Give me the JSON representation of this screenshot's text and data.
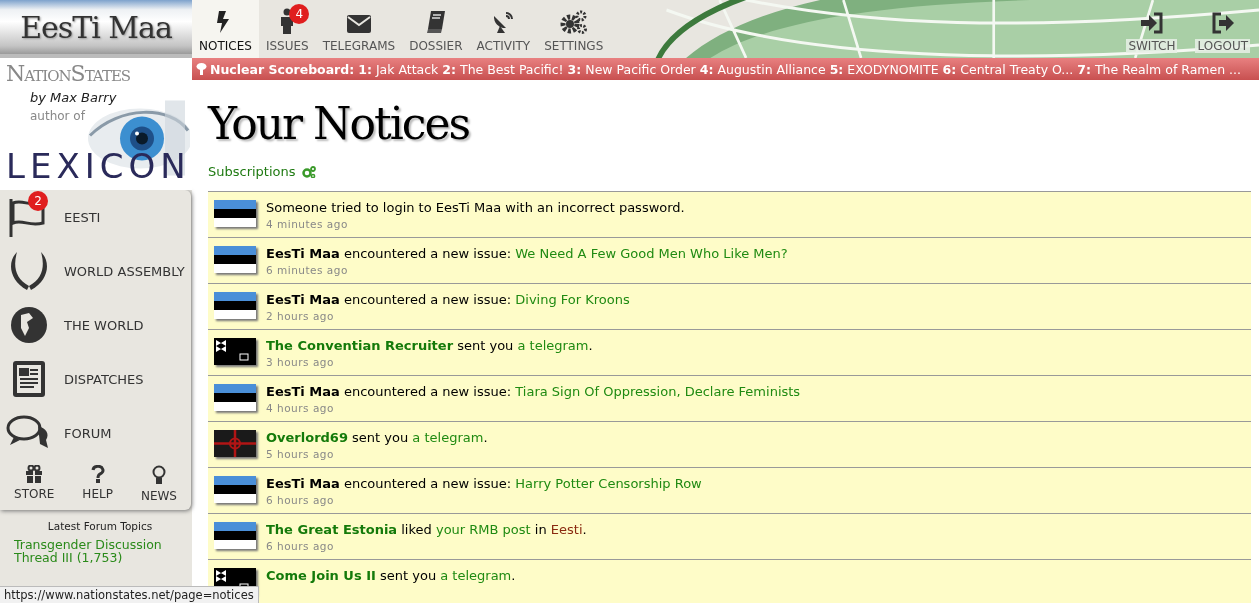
{
  "nation_banner": {
    "name": "EesTi Maa"
  },
  "nav": [
    {
      "label": "NOTICES",
      "selected": true
    },
    {
      "label": "ISSUES",
      "selected": false,
      "badge": "4"
    },
    {
      "label": "TELEGRAMS",
      "selected": false
    },
    {
      "label": "DOSSIER",
      "selected": false
    },
    {
      "label": "ACTIVITY",
      "selected": false
    },
    {
      "label": "SETTINGS",
      "selected": false
    }
  ],
  "account_nav": [
    {
      "label": "SWITCH"
    },
    {
      "label": "LOGOUT"
    }
  ],
  "ticker": {
    "label": "Nuclear Scoreboard:",
    "entries": [
      {
        "rank": "1:",
        "name": "Jak Attack"
      },
      {
        "rank": "2:",
        "name": "The Best Pacific!"
      },
      {
        "rank": "3:",
        "name": "New Pacific Order"
      },
      {
        "rank": "4:",
        "name": "Augustin Alliance"
      },
      {
        "rank": "5:",
        "name": "EXODYNOMITE"
      },
      {
        "rank": "6:",
        "name": "Central Treaty O..."
      },
      {
        "rank": "7:",
        "name": "The Realm of Ramen ..."
      }
    ]
  },
  "site_logo": "NationStates",
  "promo": {
    "byline": "by Max Barry",
    "subline": "author of",
    "book": "LEXICON"
  },
  "sidebar": {
    "items": [
      {
        "label": "EESTI",
        "badge": "2"
      },
      {
        "label": "WORLD ASSEMBLY"
      },
      {
        "label": "THE WORLD"
      },
      {
        "label": "DISPATCHES"
      },
      {
        "label": "FORUM"
      }
    ],
    "small_items": [
      {
        "label": "STORE"
      },
      {
        "label": "HELP"
      },
      {
        "label": "NEWS"
      }
    ],
    "forum_heading": "Latest Forum Topics",
    "forum_topics": [
      "Transgender Discussion Thread III (1,753)"
    ]
  },
  "page_title": "Your Notices",
  "subscriptions": "Subscriptions",
  "notices": [
    {
      "kind": "estonia",
      "parts": [
        {
          "kind": "plain",
          "text": "Someone tried to login to EesTi Maa with an incorrect password."
        }
      ],
      "time": "4 minutes ago"
    },
    {
      "kind": "estonia",
      "parts": [
        {
          "kind": "self",
          "text": "EesTi Maa"
        },
        {
          "kind": "plain",
          "text": " encountered a new issue: "
        },
        {
          "kind": "link",
          "text": "We Need A Few Good Men Who Like Men?"
        }
      ],
      "time": "6 minutes ago"
    },
    {
      "kind": "estonia",
      "parts": [
        {
          "kind": "self",
          "text": "EesTi Maa"
        },
        {
          "kind": "plain",
          "text": " encountered a new issue: "
        },
        {
          "kind": "link",
          "text": "Diving For Kroons"
        }
      ],
      "time": "2 hours ago"
    },
    {
      "kind": "black",
      "parts": [
        {
          "kind": "nation",
          "text": "The Conventian Recruiter"
        },
        {
          "kind": "plain",
          "text": " sent you "
        },
        {
          "kind": "link",
          "text": "a telegram"
        },
        {
          "kind": "plain",
          "text": "."
        }
      ],
      "time": "3 hours ago"
    },
    {
      "kind": "estonia",
      "parts": [
        {
          "kind": "self",
          "text": "EesTi Maa"
        },
        {
          "kind": "plain",
          "text": " encountered a new issue: "
        },
        {
          "kind": "link",
          "text": "Tiara Sign Of Oppression, Declare Feminists"
        }
      ],
      "time": "4 hours ago"
    },
    {
      "kind": "redcross",
      "parts": [
        {
          "kind": "nation",
          "text": "Overlord69"
        },
        {
          "kind": "plain",
          "text": " sent you "
        },
        {
          "kind": "link",
          "text": "a telegram"
        },
        {
          "kind": "plain",
          "text": "."
        }
      ],
      "time": "5 hours ago"
    },
    {
      "kind": "estonia",
      "parts": [
        {
          "kind": "self",
          "text": "EesTi Maa"
        },
        {
          "kind": "plain",
          "text": " encountered a new issue: "
        },
        {
          "kind": "link",
          "text": "Harry Potter Censorship Row"
        }
      ],
      "time": "6 hours ago"
    },
    {
      "kind": "estonia",
      "parts": [
        {
          "kind": "nation",
          "text": "The Great Estonia"
        },
        {
          "kind": "plain",
          "text": " liked "
        },
        {
          "kind": "link",
          "text": "your RMB post"
        },
        {
          "kind": "plain",
          "text": " in "
        },
        {
          "kind": "region",
          "text": "Eesti"
        },
        {
          "kind": "plain",
          "text": "."
        }
      ],
      "time": "6 hours ago"
    },
    {
      "kind": "black",
      "parts": [
        {
          "kind": "nation",
          "text": "Come Join Us II"
        },
        {
          "kind": "plain",
          "text": " sent you "
        },
        {
          "kind": "link",
          "text": "a telegram"
        },
        {
          "kind": "plain",
          "text": "."
        }
      ]
    }
  ],
  "status_bar": "https://www.nationstates.net/page=notices"
}
